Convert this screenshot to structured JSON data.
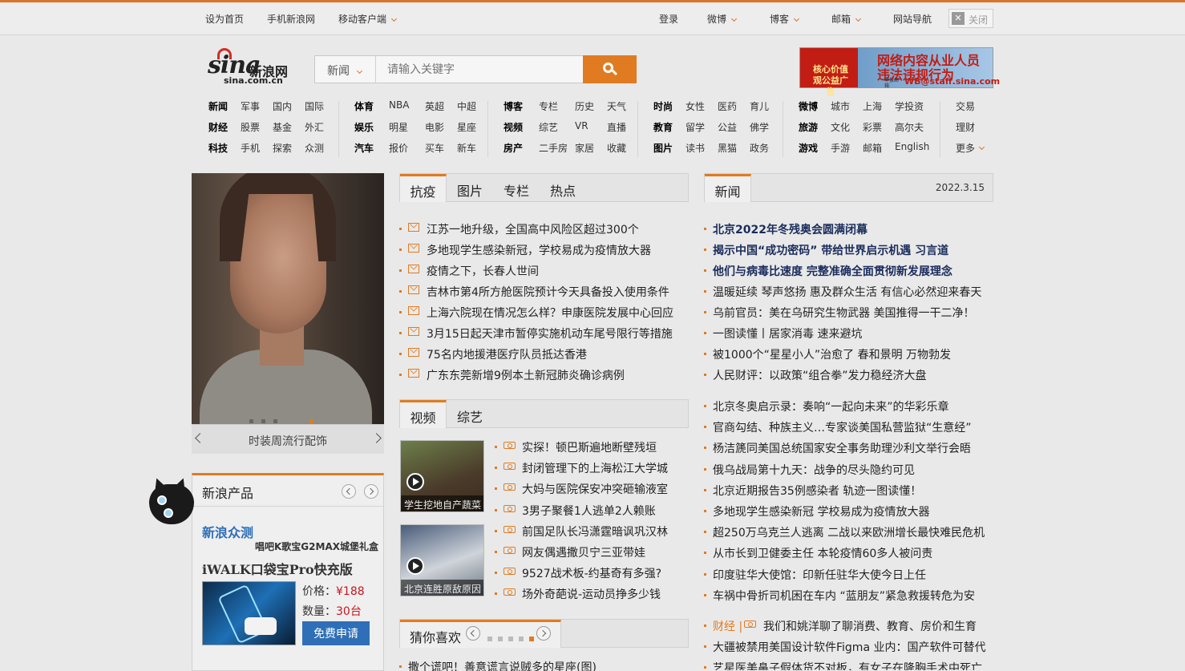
{
  "topbar": {
    "set_home": "设为首页",
    "mobile_site": "手机新浪网",
    "mobile_client": "移动客户端",
    "login": "登录",
    "weibo": "微博",
    "blog": "博客",
    "mail": "邮箱",
    "site_nav": "网站导航",
    "close": "关闭"
  },
  "logo": {
    "brand": "sina",
    "cn": "新浪网",
    "domain": "sina.com.cn"
  },
  "search": {
    "category": "新闻",
    "placeholder": "请输入关键字"
  },
  "ad": {
    "left": "核心价值观公益广告",
    "line1": "网络内容从业人员",
    "line2": "违法违规行为",
    "small": "举报邮箱",
    "email": "WB@staff.sina.com"
  },
  "nav": {
    "col1": [
      [
        "新闻",
        "军事",
        "国内",
        "国际"
      ],
      [
        "财经",
        "股票",
        "基金",
        "外汇"
      ],
      [
        "科技",
        "手机",
        "探索",
        "众测"
      ]
    ],
    "col2": [
      [
        "体育",
        "NBA",
        "英超",
        "中超"
      ],
      [
        "娱乐",
        "明星",
        "电影",
        "星座"
      ],
      [
        "汽车",
        "报价",
        "买车",
        "新车"
      ]
    ],
    "col3": [
      [
        "博客",
        "专栏",
        "历史",
        "天气"
      ],
      [
        "视频",
        "综艺",
        "VR",
        "直播"
      ],
      [
        "房产",
        "二手房",
        "家居",
        "收藏"
      ]
    ],
    "col4": [
      [
        "时尚",
        "女性",
        "医药",
        "育儿"
      ],
      [
        "教育",
        "留学",
        "公益",
        "佛学"
      ],
      [
        "图片",
        "读书",
        "黑猫",
        "政务"
      ]
    ],
    "col5": [
      [
        "微博",
        "城市",
        "上海",
        "学投资"
      ],
      [
        "旅游",
        "文化",
        "彩票",
        "高尔夫"
      ],
      [
        "游戏",
        "手游",
        "邮箱",
        "English"
      ]
    ],
    "col6": [
      "交易",
      "理财",
      "更多"
    ]
  },
  "slide": {
    "caption": "时装周流行配饰"
  },
  "products": {
    "title": "新浪产品",
    "zc": "新浪众测",
    "sub": "唱吧K歌宝G2MAX城堡礼盒",
    "name": "iWALK口袋宝Pro快充版",
    "price_label": "价格：",
    "price": "¥188",
    "qty_label": "数量：",
    "qty": "30台",
    "apply": "免费申请"
  },
  "tabs1": [
    "抗疫",
    "图片",
    "专栏",
    "热点"
  ],
  "list1": [
    "江苏一地升级，全国高中风险区超过300个",
    "多地现学生感染新冠，学校易成为疫情放大器",
    "疫情之下，长春人世间",
    "吉林市第4所方舱医院预计今天具备投入使用条件",
    "上海六院现在情况怎么样？申康医院发展中心回应",
    "3月15日起天津市暂停实施机动车尾号限行等措施",
    "75名内地援港医疗队员抵达香港",
    "广东东莞新增9例本土新冠肺炎确诊病例"
  ],
  "tabs2": [
    "视频",
    "综艺"
  ],
  "thumbs": [
    "学生挖地自产蔬菜",
    "北京连胜原敌原因"
  ],
  "list2": [
    "实探！顿巴斯遍地断壁残垣",
    "封闭管理下的上海松江大学城",
    "大妈与医院保安冲突砸输液室",
    "3男子聚餐1人逃单2人赖账",
    "前国足队长冯潇霆暗讽巩汉林",
    "网友偶遇撒贝宁三亚带娃",
    "9527战术板-约基奇有多强?",
    "场外奇葩说-运动员挣多少钱"
  ],
  "guess": {
    "title": "猜你喜欢",
    "first": "撒个谎吧！善意谎言说贼多的星座(图)"
  },
  "news": {
    "tab": "新闻",
    "date": "2022.3.15",
    "bold": [
      "北京2022年冬残奥会圆满闭幕",
      "揭示中国“成功密码” 带给世界启示机遇 习言道",
      "他们与病毒比速度 完整准确全面贯彻新发展理念"
    ],
    "items1": [
      "温暖延续 琴声悠扬 惠及群众生活 有信心必然迎来春天",
      "乌前官员：美在乌研究生物武器 美国推得一干二净！",
      "一图读懂丨居家消毒 速来避坑",
      "被1000个“星星小人”治愈了 春和景明 万物勃发",
      "人民财评：以政策“组合拳”发力稳经济大盘"
    ],
    "items2": [
      "北京冬奥启示录：奏响“一起向未来”的华彩乐章",
      "官商勾结、种族主义…专家谈美国私营监狱“生意经”",
      "杨洁篪同美国总统国家安全事务助理沙利文举行会晤",
      "俄乌战局第十九天：战争的尽头隐约可见",
      "北京近期报告35例感染者 轨迹一图读懂！",
      "多地现学生感染新冠 学校易成为疫情放大器",
      "超250万乌克兰人逃离 二战以来欧洲增长最快难民危机",
      "从市长到卫健委主任 本轮疫情60多人被问责",
      "印度驻华大使馆：印新任驻华大使今日上任",
      "车祸中骨折司机困在车内 “蓝朋友”紧急救援转危为安"
    ],
    "finance_tag": "财经 |",
    "finance_item": "我们和姚洋聊了聊消费、教育、房价和生育",
    "items3": [
      "大疆被禁用美国设计软件Figma 业内：国产软件可替代",
      "艺星医美鼻子假体货不对板，有女子在隆胸手术中死亡"
    ]
  }
}
